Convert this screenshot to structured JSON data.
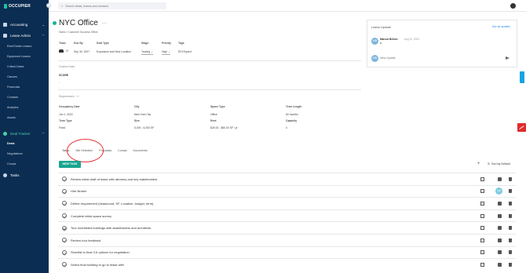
{
  "app": {
    "logo": "OCCUPIER"
  },
  "sidebar": {
    "accounting": "Accounting",
    "lease_admin": "Lease Admin",
    "lease_items": [
      "Real Estate Leases",
      "Equipment Leases",
      "Critical Dates",
      "Clauses",
      "Financials",
      "Contacts",
      "Analytics",
      "Assets"
    ],
    "deal_tracker": "Deal Tracker",
    "deal_items": [
      "Deals",
      "Negotiations",
      "Comps"
    ],
    "tasks": "Tasks"
  },
  "search": {
    "placeholder": "Search deals, leases and contacts"
  },
  "header": {
    "title": "NYC Office",
    "breadcrumb": "Sales / Customer Success Office"
  },
  "deal_info": {
    "team_label": "Team",
    "team_value": "2+",
    "due_by_label": "Due By",
    "due_by_value": "Sep 30, 2027",
    "deal_type_label": "Deal Type",
    "deal_type_value": "Expansion and New Location",
    "stage_label": "Stage",
    "stage_value": "Touring",
    "priority_label": "Priority",
    "priority_value": "High",
    "tags_label": "Tags",
    "tags_value": "EDI Expect"
  },
  "custom_data": {
    "label": "Custom Data",
    "field_label": "SCORE",
    "field_value": "-"
  },
  "requirement": {
    "label": "Requirement",
    "occupancy_date_label": "Occupancy Date",
    "occupancy_date_value": "Jun 1, 2022",
    "city_label": "City",
    "city_value": "New York City",
    "space_type_label": "Space Type",
    "space_type_value": "Office",
    "term_length_label": "Term Length",
    "term_length_value": "60 months",
    "term_type_label": "Term Type",
    "term_type_value": "Fixed",
    "size_label": "Size",
    "size_value": "5,000 - 6,000 SF",
    "rent_label": "Rent",
    "rent_value": "$25.00 - $60.00 SF / yr",
    "capacity_label": "Capacity",
    "capacity_value": "0"
  },
  "updates": {
    "title": "Latest Update",
    "see_all": "See all updates",
    "author_initials": "MB",
    "author": "Marcus Belluci",
    "date": "Aug 22, 2023",
    "body": "a",
    "me_initials": "MB",
    "input_placeholder": "New Update"
  },
  "tabs": [
    "Tasks",
    "Site Selection",
    "Proposals",
    "Comps",
    "Documents"
  ],
  "task_toolbar": {
    "new_task": "NEW TASK",
    "sort": "Sort by Default"
  },
  "tasks": [
    {
      "text": "Review initial draft of lease with attorney and key stakeholders"
    },
    {
      "text": "Hire Broker",
      "assignee": "MB"
    },
    {
      "text": "Define requirement (headcount, SF, Location, budget, term)."
    },
    {
      "text": "Complete initial space survey"
    },
    {
      "text": "Tour shortlisted buildings with stakeholders and architects."
    },
    {
      "text": "Review tour feedback"
    },
    {
      "text": "Shortlist to final 3-5 options for negotiation"
    },
    {
      "text": "Select final building to go to lease with"
    }
  ]
}
